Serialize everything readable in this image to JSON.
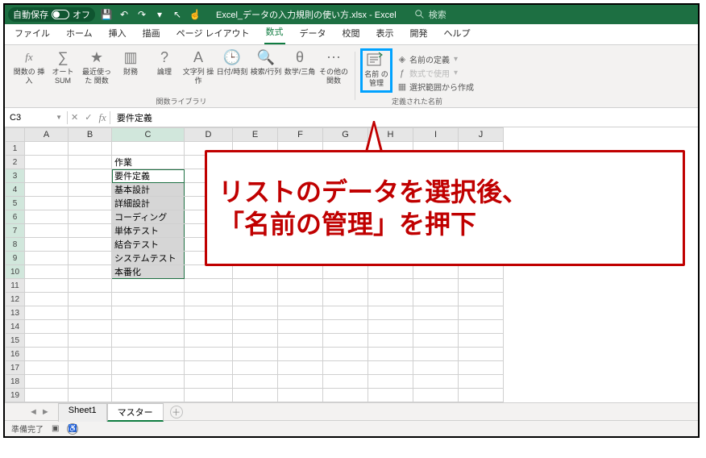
{
  "titlebar": {
    "autosave_label": "自動保存",
    "autosave_state": "オフ",
    "filename": "Excel_データの入力規則の使い方.xlsx - Excel",
    "search_label": "検索"
  },
  "menu": {
    "items": [
      "ファイル",
      "ホーム",
      "挿入",
      "描画",
      "ページ レイアウト",
      "数式",
      "データ",
      "校閲",
      "表示",
      "開発",
      "ヘルプ"
    ],
    "active_index": 5
  },
  "ribbon": {
    "insert_fn": "関数の\n挿入",
    "autosum": "オート\nSUM",
    "recent": "最近使った\n関数",
    "finance": "財務",
    "logic": "論理",
    "text": "文字列\n操作",
    "datetime": "日付/時刻",
    "lookup": "検索/行列",
    "math": "数学/三角",
    "other": "その他の\n関数",
    "group_library": "関数ライブラリ",
    "name_mgr": "名前\nの管理",
    "name_define": "名前の定義",
    "name_use": "数式で使用",
    "name_create": "選択範囲から作成",
    "group_names": "定義された名前"
  },
  "fbar": {
    "namebox": "C3",
    "value": "要件定義"
  },
  "grid": {
    "cols": [
      "A",
      "B",
      "C",
      "D",
      "E",
      "F",
      "G",
      "H",
      "I",
      "J"
    ],
    "rows": 19,
    "c_header": "作業",
    "c_values": [
      "要件定義",
      "基本設計",
      "詳細設計",
      "コーディング",
      "単体テスト",
      "結合テスト",
      "システムテスト",
      "本番化"
    ],
    "active_col_index": 2,
    "active_row_index": 2
  },
  "callout": {
    "line1": "リストのデータを選択後、",
    "line2": "「名前の管理」を押下"
  },
  "sheets": {
    "tabs": [
      "Sheet1",
      "マスター"
    ],
    "active_index": 1
  },
  "status": {
    "ready": "準備完了"
  }
}
